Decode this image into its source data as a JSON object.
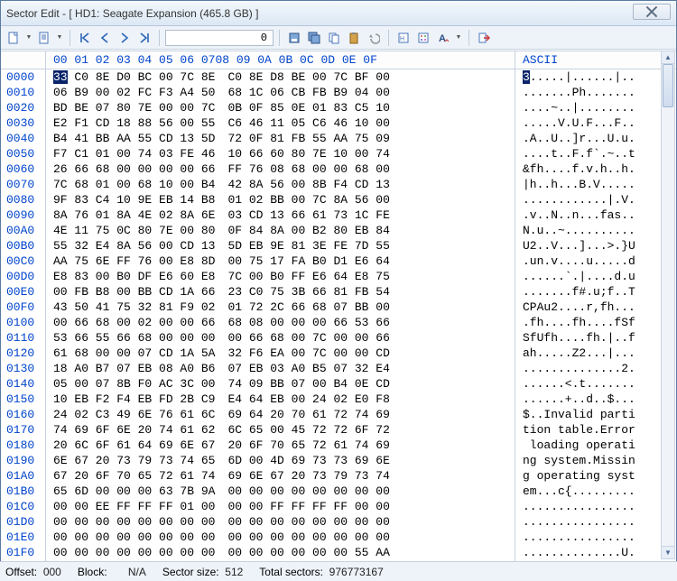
{
  "window": {
    "title": "Sector Edit - [ HD1: Seagate Expansion (465.8 GB) ]"
  },
  "toolbar": {
    "number": "0"
  },
  "header": {
    "cols1": "00 01 02 03 04 05 06 07",
    "cols2": "08 09 0A 0B 0C 0D 0E 0F",
    "ascii": "ASCII"
  },
  "rows": [
    {
      "o": "0000",
      "h1": "33 C0 8E D0 BC 00 7C 8E",
      "h2": "C0 8E D8 BE 00 7C BF 00",
      "a": "3.....|......|.."
    },
    {
      "o": "0010",
      "h1": "06 B9 00 02 FC F3 A4 50",
      "h2": "68 1C 06 CB FB B9 04 00",
      "a": ".......Ph......."
    },
    {
      "o": "0020",
      "h1": "BD BE 07 80 7E 00 00 7C",
      "h2": "0B 0F 85 0E 01 83 C5 10",
      "a": "....~..|........"
    },
    {
      "o": "0030",
      "h1": "E2 F1 CD 18 88 56 00 55",
      "h2": "C6 46 11 05 C6 46 10 00",
      "a": ".....V.U.F...F.."
    },
    {
      "o": "0040",
      "h1": "B4 41 BB AA 55 CD 13 5D",
      "h2": "72 0F 81 FB 55 AA 75 09",
      "a": ".A..U..]r...U.u."
    },
    {
      "o": "0050",
      "h1": "F7 C1 01 00 74 03 FE 46",
      "h2": "10 66 60 80 7E 10 00 74",
      "a": "....t..F.f`.~..t"
    },
    {
      "o": "0060",
      "h1": "26 66 68 00 00 00 00 66",
      "h2": "FF 76 08 68 00 00 68 00",
      "a": "&fh....f.v.h..h."
    },
    {
      "o": "0070",
      "h1": "7C 68 01 00 68 10 00 B4",
      "h2": "42 8A 56 00 8B F4 CD 13",
      "a": "|h..h...B.V....."
    },
    {
      "o": "0080",
      "h1": "9F 83 C4 10 9E EB 14 B8",
      "h2": "01 02 BB 00 7C 8A 56 00",
      "a": "............|.V."
    },
    {
      "o": "0090",
      "h1": "8A 76 01 8A 4E 02 8A 6E",
      "h2": "03 CD 13 66 61 73 1C FE",
      "a": ".v..N..n...fas.."
    },
    {
      "o": "00A0",
      "h1": "4E 11 75 0C 80 7E 00 80",
      "h2": "0F 84 8A 00 B2 80 EB 84",
      "a": "N.u..~.........."
    },
    {
      "o": "00B0",
      "h1": "55 32 E4 8A 56 00 CD 13",
      "h2": "5D EB 9E 81 3E FE 7D 55",
      "a": "U2..V...]...>.}U"
    },
    {
      "o": "00C0",
      "h1": "AA 75 6E FF 76 00 E8 8D",
      "h2": "00 75 17 FA B0 D1 E6 64",
      "a": ".un.v....u.....d"
    },
    {
      "o": "00D0",
      "h1": "E8 83 00 B0 DF E6 60 E8",
      "h2": "7C 00 B0 FF E6 64 E8 75",
      "a": "......`.|....d.u"
    },
    {
      "o": "00E0",
      "h1": "00 FB B8 00 BB CD 1A 66",
      "h2": "23 C0 75 3B 66 81 FB 54",
      "a": ".......f#.u;f..T"
    },
    {
      "o": "00F0",
      "h1": "43 50 41 75 32 81 F9 02",
      "h2": "01 72 2C 66 68 07 BB 00",
      "a": "CPAu2....r,fh..."
    },
    {
      "o": "0100",
      "h1": "00 66 68 00 02 00 00 66",
      "h2": "68 08 00 00 00 66 53 66",
      "a": ".fh....fh....fSf"
    },
    {
      "o": "0110",
      "h1": "53 66 55 66 68 00 00 00",
      "h2": "00 66 68 00 7C 00 00 66",
      "a": "SfUfh....fh.|..f"
    },
    {
      "o": "0120",
      "h1": "61 68 00 00 07 CD 1A 5A",
      "h2": "32 F6 EA 00 7C 00 00 CD",
      "a": "ah.....Z2...|..."
    },
    {
      "o": "0130",
      "h1": "18 A0 B7 07 EB 08 A0 B6",
      "h2": "07 EB 03 A0 B5 07 32 E4",
      "a": "..............2."
    },
    {
      "o": "0140",
      "h1": "05 00 07 8B F0 AC 3C 00",
      "h2": "74 09 BB 07 00 B4 0E CD",
      "a": "......<.t......."
    },
    {
      "o": "0150",
      "h1": "10 EB F2 F4 EB FD 2B C9",
      "h2": "E4 64 EB 00 24 02 E0 F8",
      "a": "......+..d..$..."
    },
    {
      "o": "0160",
      "h1": "24 02 C3 49 6E 76 61 6C",
      "h2": "69 64 20 70 61 72 74 69",
      "a": "$..Invalid parti"
    },
    {
      "o": "0170",
      "h1": "74 69 6F 6E 20 74 61 62",
      "h2": "6C 65 00 45 72 72 6F 72",
      "a": "tion table.Error"
    },
    {
      "o": "0180",
      "h1": "20 6C 6F 61 64 69 6E 67",
      "h2": "20 6F 70 65 72 61 74 69",
      "a": " loading operati"
    },
    {
      "o": "0190",
      "h1": "6E 67 20 73 79 73 74 65",
      "h2": "6D 00 4D 69 73 73 69 6E",
      "a": "ng system.Missin"
    },
    {
      "o": "01A0",
      "h1": "67 20 6F 70 65 72 61 74",
      "h2": "69 6E 67 20 73 79 73 74",
      "a": "g operating syst"
    },
    {
      "o": "01B0",
      "h1": "65 6D 00 00 00 63 7B 9A",
      "h2": "00 00 00 00 00 00 00 00",
      "a": "em...c{........."
    },
    {
      "o": "01C0",
      "h1": "00 00 EE FF FF FF 01 00",
      "h2": "00 00 FF FF FF FF 00 00",
      "a": "................"
    },
    {
      "o": "01D0",
      "h1": "00 00 00 00 00 00 00 00",
      "h2": "00 00 00 00 00 00 00 00",
      "a": "................"
    },
    {
      "o": "01E0",
      "h1": "00 00 00 00 00 00 00 00",
      "h2": "00 00 00 00 00 00 00 00",
      "a": "................"
    },
    {
      "o": "01F0",
      "h1": "00 00 00 00 00 00 00 00",
      "h2": "00 00 00 00 00 00 55 AA",
      "a": "..............U."
    }
  ],
  "status": {
    "offset_lbl": "Offset:",
    "offset_val": "000",
    "block_lbl": "Block:",
    "block_val": "N/A",
    "sector_lbl": "Sector size:",
    "sector_val": "512",
    "total_lbl": "Total sectors:",
    "total_val": "976773167"
  }
}
